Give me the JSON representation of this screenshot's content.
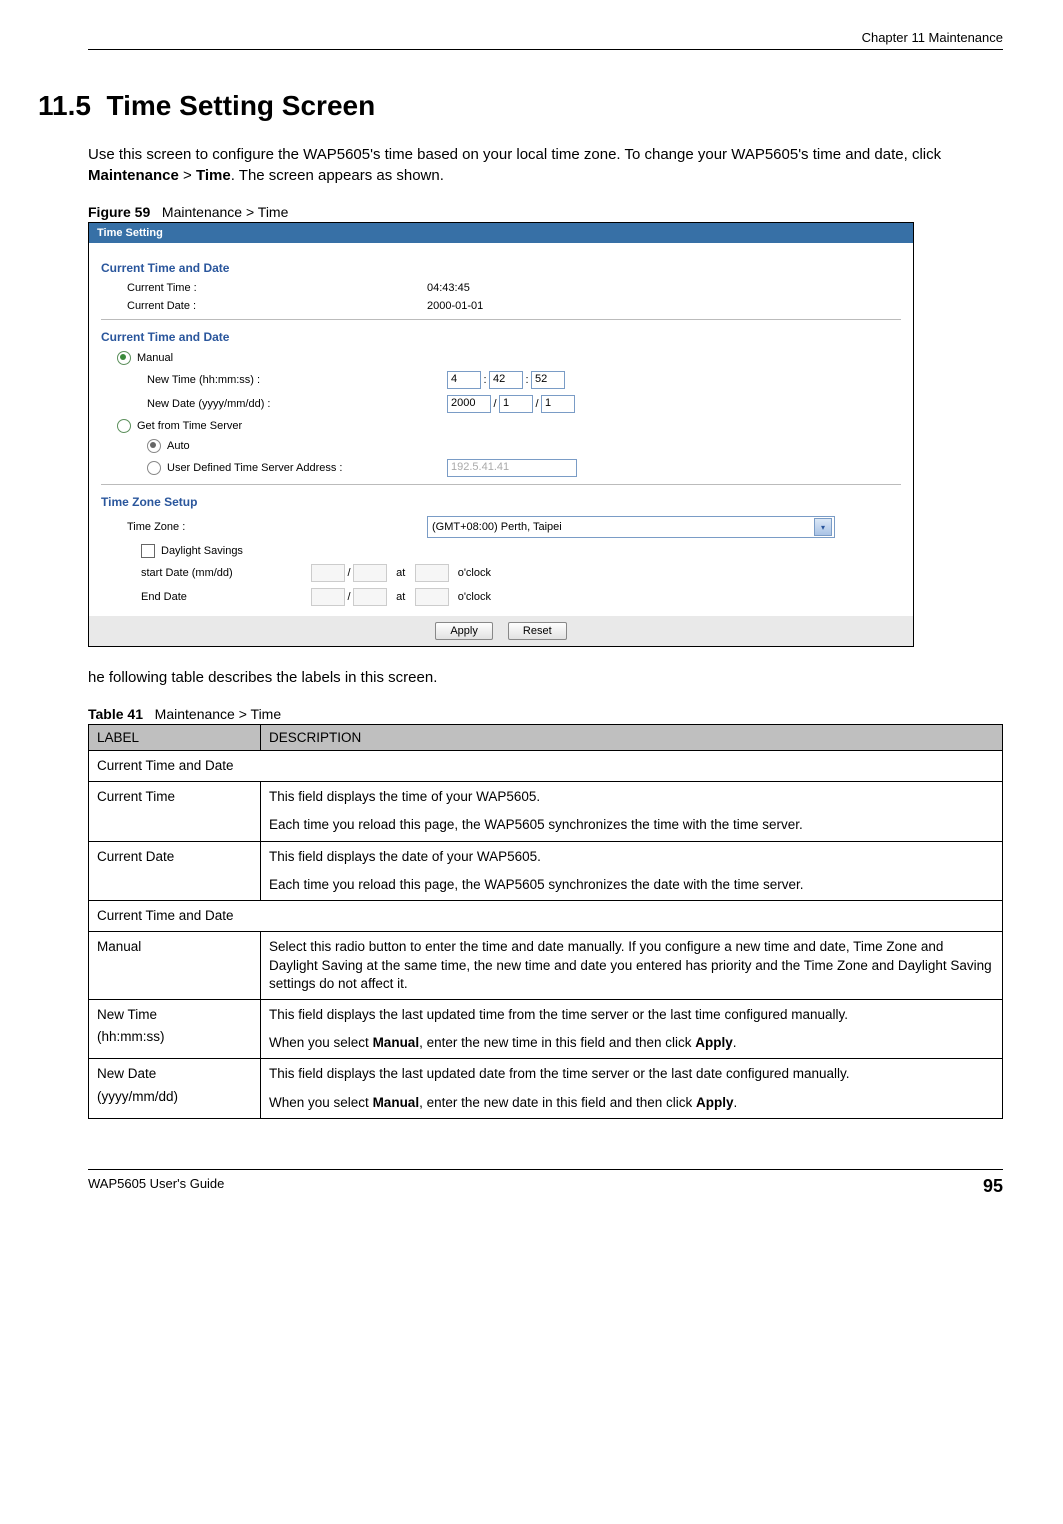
{
  "header": {
    "chapter": "Chapter 11 Maintenance"
  },
  "section": {
    "number": "11.5",
    "title": "Time Setting Screen",
    "intro_a": "Use this screen to configure the WAP5605's time based on your local time zone. To change your WAP5605's time and date, click ",
    "intro_b_strong": "Maintenance",
    "intro_c": " > ",
    "intro_d_strong": "Time",
    "intro_e": ". The screen appears as shown."
  },
  "figure": {
    "label": "Figure 59",
    "caption": "Maintenance > Time"
  },
  "screenshot": {
    "title": "Time Setting",
    "group1_title": "Current Time and Date",
    "current_time_label": "Current Time :",
    "current_time_value": "04:43:45",
    "current_date_label": "Current Date :",
    "current_date_value": "2000-01-01",
    "group2_title": "Current Time and Date",
    "manual_label": "Manual",
    "new_time_label": "New Time (hh:mm:ss) :",
    "hh": "4",
    "mm": "42",
    "ss": "52",
    "new_date_label": "New Date (yyyy/mm/dd) :",
    "yyyy": "2000",
    "mo": "1",
    "dd": "1",
    "get_server_label": "Get from Time Server",
    "auto_label": "Auto",
    "user_def_label": "User Defined Time Server Address :",
    "server_ip": "192.5.41.41",
    "group3_title": "Time Zone Setup",
    "tz_label": "Time Zone :",
    "tz_value": "(GMT+08:00) Perth, Taipei",
    "daylight_label": "Daylight Savings",
    "start_label": "start Date (mm/dd)",
    "end_label": "End Date",
    "at_text": "at",
    "oclock_text": "o'clock",
    "apply": "Apply",
    "reset": "Reset"
  },
  "between_text": "he following table describes the labels in this screen.",
  "table": {
    "label": "Table 41",
    "caption": "Maintenance > Time",
    "col_label": "LABEL",
    "col_desc": "DESCRIPTION",
    "rows": {
      "sec1": "Current Time and Date",
      "r1_label": "Current Time",
      "r1_p1": "This field displays the time of your WAP5605.",
      "r1_p2": "Each time you reload this page, the WAP5605 synchronizes the time with the time server.",
      "r2_label": "Current Date",
      "r2_p1": "This field displays the date of your WAP5605.",
      "r2_p2": "Each time you reload this page, the WAP5605 synchronizes the date with the time server.",
      "sec2": "Current Time and Date",
      "r3_label": "Manual",
      "r3_p1": "Select this radio button to enter the time and date manually. If you configure a new time and date, Time Zone and Daylight Saving at the same time, the new time and date you entered has priority and the Time Zone and Daylight Saving settings do not affect it.",
      "r4_label_a": "New Time",
      "r4_label_b": "(hh:mm:ss)",
      "r4_p1": "This field displays the last updated time from the time server or the last time configured manually.",
      "r4_p2a": "When you select ",
      "r4_p2b_strong": "Manual",
      "r4_p2c": ", enter the new time in this field and then click ",
      "r4_p2d_strong": "Apply",
      "r4_p2e": ".",
      "r5_label_a": "New Date",
      "r5_label_b": "(yyyy/mm/dd)",
      "r5_p1": "This field displays the last updated date from the time server or the last date configured manually.",
      "r5_p2a": "When you select ",
      "r5_p2b_strong": "Manual",
      "r5_p2c": ", enter the new date in this field and then click ",
      "r5_p2d_strong": "Apply",
      "r5_p2e": "."
    }
  },
  "footer": {
    "guide": "WAP5605 User's Guide",
    "page": "95"
  }
}
